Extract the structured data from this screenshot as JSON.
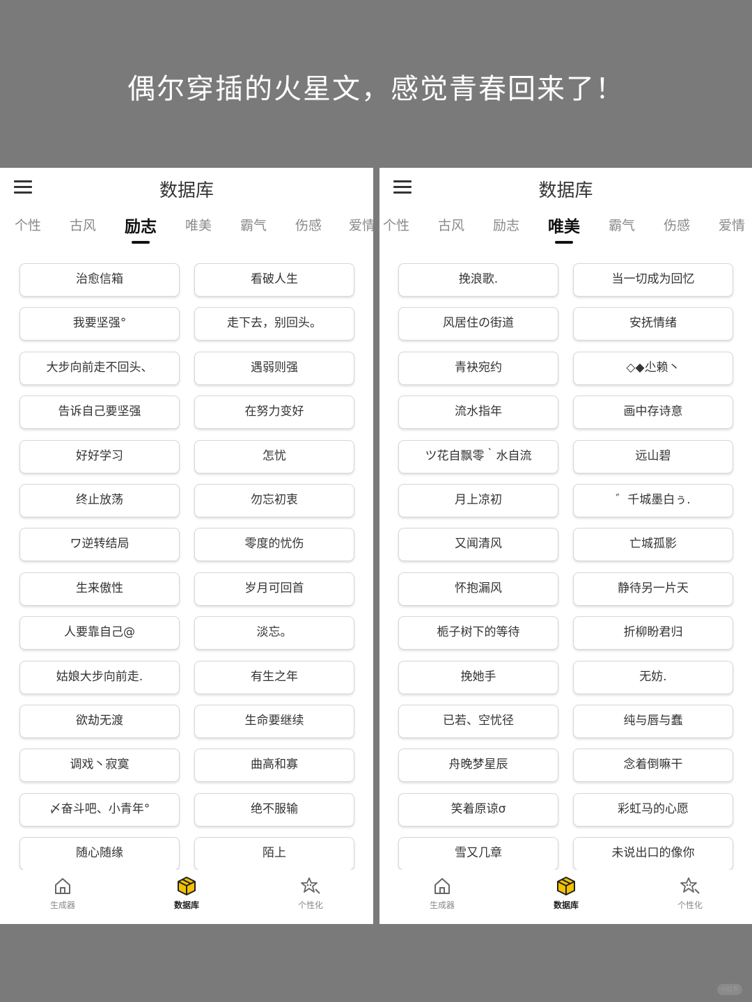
{
  "headline": "偶尔穿插的火星文，感觉青春回来了！",
  "watermark": "小红书",
  "colors": {
    "background": "#7a7a7a",
    "panel": "#ffffff",
    "accent": "#f2c200",
    "text": "#333333"
  },
  "left_screen": {
    "title": "数据库",
    "tabs": [
      "个性",
      "古风",
      "励志",
      "唯美",
      "霸气",
      "伤感",
      "爱情"
    ],
    "active_tab": "励志",
    "items": [
      [
        "治愈信箱",
        "看破人生"
      ],
      [
        "我要坚强°",
        "走下去，别回头。"
      ],
      [
        "大步向前走不回头、",
        "遇弱则强"
      ],
      [
        "告诉自己要坚强",
        "在努力变好"
      ],
      [
        "好好学习",
        "怎忧"
      ],
      [
        "终止放荡",
        "勿忘初衷"
      ],
      [
        "ワ逆转结局",
        "零度的忧伤"
      ],
      [
        "生来傲性",
        "岁月可回首"
      ],
      [
        "人要靠自己@",
        "淡忘。"
      ],
      [
        "姑娘大步向前走.",
        "有生之年"
      ],
      [
        "欲劫无渡",
        "生命要继续"
      ],
      [
        "调戏丶寂寞",
        "曲高和寡"
      ],
      [
        "〆奋斗吧、小青年°",
        "绝不服输"
      ],
      [
        "随心随缘",
        "陌上"
      ]
    ],
    "nav": [
      {
        "label": "生成器",
        "icon": "home-icon"
      },
      {
        "label": "数据库",
        "icon": "database-cube-icon"
      },
      {
        "label": "个性化",
        "icon": "sparkle-star-icon"
      }
    ],
    "active_nav": "数据库"
  },
  "right_screen": {
    "title": "数据库",
    "tabs": [
      "个性",
      "古风",
      "励志",
      "唯美",
      "霸气",
      "伤感",
      "爱情"
    ],
    "active_tab": "唯美",
    "items": [
      [
        "挽浪歌.",
        "当一切成为回忆"
      ],
      [
        "风居住の街道",
        "安抚情绪"
      ],
      [
        "青袂宛约",
        "◇◆尐赖丶"
      ],
      [
        "流水指年",
        "画中存诗意"
      ],
      [
        "ツ花自飘零｀水自流",
        "远山碧"
      ],
      [
        "月上凉初",
        "゛千城墨白ぅ."
      ],
      [
        "又闻清风",
        "亡城孤影"
      ],
      [
        "怀抱漏风",
        "静待另一片天"
      ],
      [
        "栀子树下的等待",
        "折柳盼君归"
      ],
      [
        "挽她手",
        "无妨."
      ],
      [
        "已若、空忧径",
        "纯与唇与蠢"
      ],
      [
        "舟晚梦星辰",
        "念着倒嘛干"
      ],
      [
        "笑着原谅σ",
        "彩虹马的心愿"
      ],
      [
        "雪又几章",
        "未说出口的像你"
      ]
    ],
    "nav": [
      {
        "label": "生成器",
        "icon": "home-icon"
      },
      {
        "label": "数据库",
        "icon": "database-cube-icon"
      },
      {
        "label": "个性化",
        "icon": "sparkle-star-icon"
      }
    ],
    "active_nav": "数据库"
  }
}
